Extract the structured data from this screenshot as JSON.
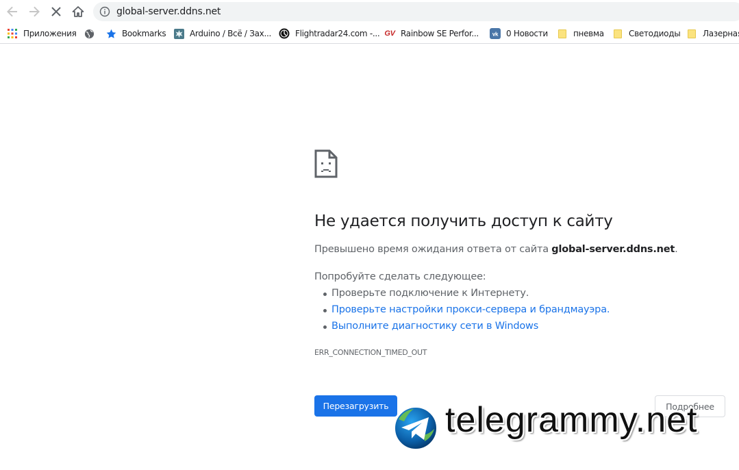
{
  "toolbar": {
    "back_icon": "arrow-left-icon",
    "forward_icon": "arrow-right-icon",
    "stop_icon": "close-icon",
    "home_icon": "home-icon",
    "info_icon": "info-icon",
    "url": "global-server.ddns.net"
  },
  "bookmarks": [
    {
      "label": "Приложения",
      "icon": "apps-grid-icon"
    },
    {
      "label": "",
      "icon": "globe-icon"
    },
    {
      "label": "Bookmarks",
      "icon": "star-icon"
    },
    {
      "label": "Arduino / Всё / Зах...",
      "icon": "arduino-icon"
    },
    {
      "label": "Flightradar24.com -...",
      "icon": "flightradar-icon"
    },
    {
      "label": "Rainbow SE Perfor...",
      "icon": "gv-icon"
    },
    {
      "label": "0 Новости",
      "icon": "vk-icon"
    },
    {
      "label": "пневма",
      "icon": "folder-icon"
    },
    {
      "label": "Светодиоды",
      "icon": "folder-icon"
    },
    {
      "label": "Лазерная",
      "icon": "folder-icon"
    }
  ],
  "error": {
    "icon": "sad-page-icon",
    "title": "Не удается получить доступ к сайту",
    "message_prefix": "Превышено время ожидания ответа от сайта ",
    "message_host": "global-server.ddns.net",
    "message_suffix": ".",
    "try_title": "Попробуйте сделать следующее:",
    "suggestions": [
      "Проверьте подключение к Интернету.",
      "Проверьте настройки прокси-сервера и брандмауэра.",
      "Выполните диагностику сети в Windows"
    ],
    "code": "ERR_CONNECTION_TIMED_OUT",
    "reload_label": "Перезагрузить",
    "details_label": "Подробнее"
  },
  "watermark": {
    "text": "telegrammy.net",
    "icon": "telegram-logo-icon"
  },
  "colors": {
    "accent": "#1a73e8",
    "link": "#1a73e8",
    "text": "#202124",
    "secondary_text": "#5f6368"
  }
}
